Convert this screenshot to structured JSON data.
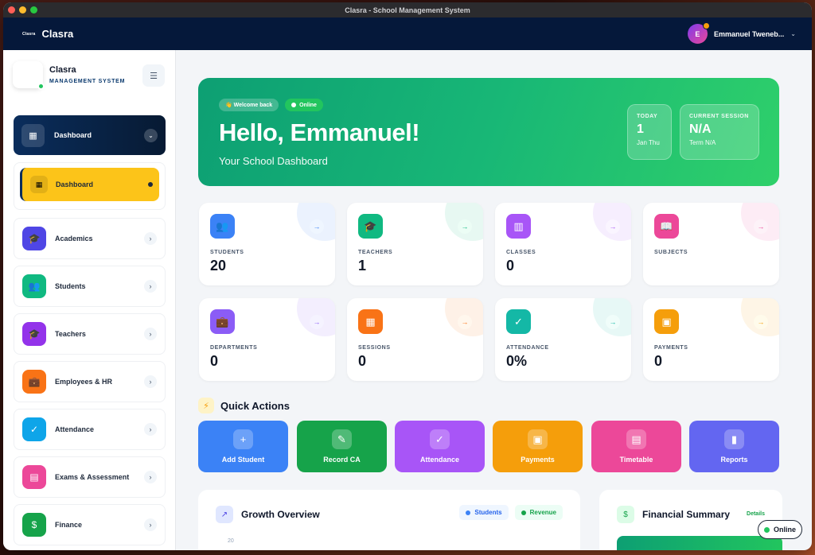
{
  "window": {
    "title": "Clasra - School Management System"
  },
  "appbar": {
    "logo_text": "Clasra",
    "brand": "Clasra",
    "user_initial": "E",
    "user_name": "Emmanuel Tweneb..."
  },
  "sidebar": {
    "title": "Clasra",
    "subtitle": "MANAGEMENT SYSTEM",
    "active_group": "Dashboard",
    "active_item": "Dashboard",
    "items": [
      {
        "label": "Academics",
        "color": "#4f46e5"
      },
      {
        "label": "Students",
        "color": "#10b981"
      },
      {
        "label": "Teachers",
        "color": "#9333ea"
      },
      {
        "label": "Employees & HR",
        "color": "#f97316"
      },
      {
        "label": "Attendance",
        "color": "#0ea5e9"
      },
      {
        "label": "Exams & Assessment",
        "color": "#ec4899"
      },
      {
        "label": "Finance",
        "color": "#16a34a"
      }
    ]
  },
  "hero": {
    "pill_welcome": "👋 Welcome back",
    "pill_online": "Online",
    "greeting": "Hello, Emmanuel!",
    "subtitle": "Your School Dashboard",
    "today_caption": "TODAY",
    "today_value": "1",
    "today_sub": "Jan Thu",
    "session_caption": "CURRENT SESSION",
    "session_value": "N/A",
    "session_sub": "Term N/A"
  },
  "stats": [
    {
      "label": "STUDENTS",
      "value": "20",
      "color": "#3b82f6",
      "icon": "users-icon"
    },
    {
      "label": "TEACHERS",
      "value": "1",
      "color": "#10b981",
      "icon": "graduation-cap-icon"
    },
    {
      "label": "CLASSES",
      "value": "0",
      "color": "#a855f7",
      "icon": "building-icon"
    },
    {
      "label": "SUBJECTS",
      "value": "",
      "color": "#ec4899",
      "icon": "book-icon"
    },
    {
      "label": "DEPARTMENTS",
      "value": "0",
      "color": "#8b5cf6",
      "icon": "briefcase-icon"
    },
    {
      "label": "SESSIONS",
      "value": "0",
      "color": "#f97316",
      "icon": "calendar-icon"
    },
    {
      "label": "ATTENDANCE",
      "value": "0%",
      "color": "#14b8a6",
      "icon": "clipboard-icon"
    },
    {
      "label": "PAYMENTS",
      "value": "0",
      "color": "#f59e0b",
      "icon": "money-icon"
    }
  ],
  "quick_actions": {
    "title": "Quick Actions",
    "items": [
      {
        "label": "Add Student",
        "color": "#3b82f6",
        "icon": "plus-icon"
      },
      {
        "label": "Record CA",
        "color": "#16a34a",
        "icon": "pencil-icon"
      },
      {
        "label": "Attendance",
        "color": "#a855f7",
        "icon": "clipboard-check-icon"
      },
      {
        "label": "Payments",
        "color": "#f59e0b",
        "icon": "money-icon"
      },
      {
        "label": "Timetable",
        "color": "#ec4899",
        "icon": "table-icon"
      },
      {
        "label": "Reports",
        "color": "#6366f1",
        "icon": "bar-chart-icon"
      }
    ]
  },
  "growth": {
    "title": "Growth Overview",
    "legend_students": "Students",
    "legend_revenue": "Revenue",
    "y_tick": "20"
  },
  "financial": {
    "title": "Financial Summary",
    "details": "Details"
  },
  "status": {
    "online": "Online"
  }
}
